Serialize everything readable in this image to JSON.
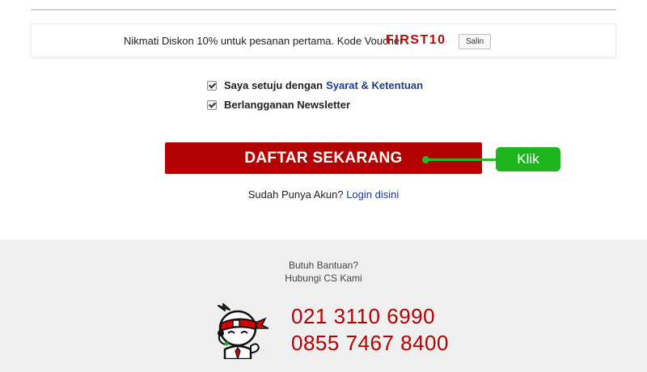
{
  "voucher": {
    "text": "Nikmati Diskon 10% untuk pesanan pertama. Kode Voucher :",
    "code": "FIRST10",
    "copy_label": "Salin"
  },
  "agreements": {
    "terms_prefix": "Saya setuju dengan",
    "terms_link": "Syarat & Ketentuan",
    "newsletter_label": "Berlangganan Newsletter"
  },
  "register": {
    "button_label": "DAFTAR SEKARANG",
    "annotation_label": "Klik"
  },
  "login": {
    "prompt": "Sudah Punya Akun?",
    "link": "Login disini"
  },
  "footer": {
    "help_title": "Butuh Bantuan?",
    "help_subtitle": "Hubungi CS Kami",
    "phones": [
      "021 3110 6990",
      "0855 7467 8400"
    ]
  },
  "colors": {
    "brand_red": "#b30000",
    "link_blue": "#1f3a8c",
    "annotation_green": "#1fb51f"
  }
}
